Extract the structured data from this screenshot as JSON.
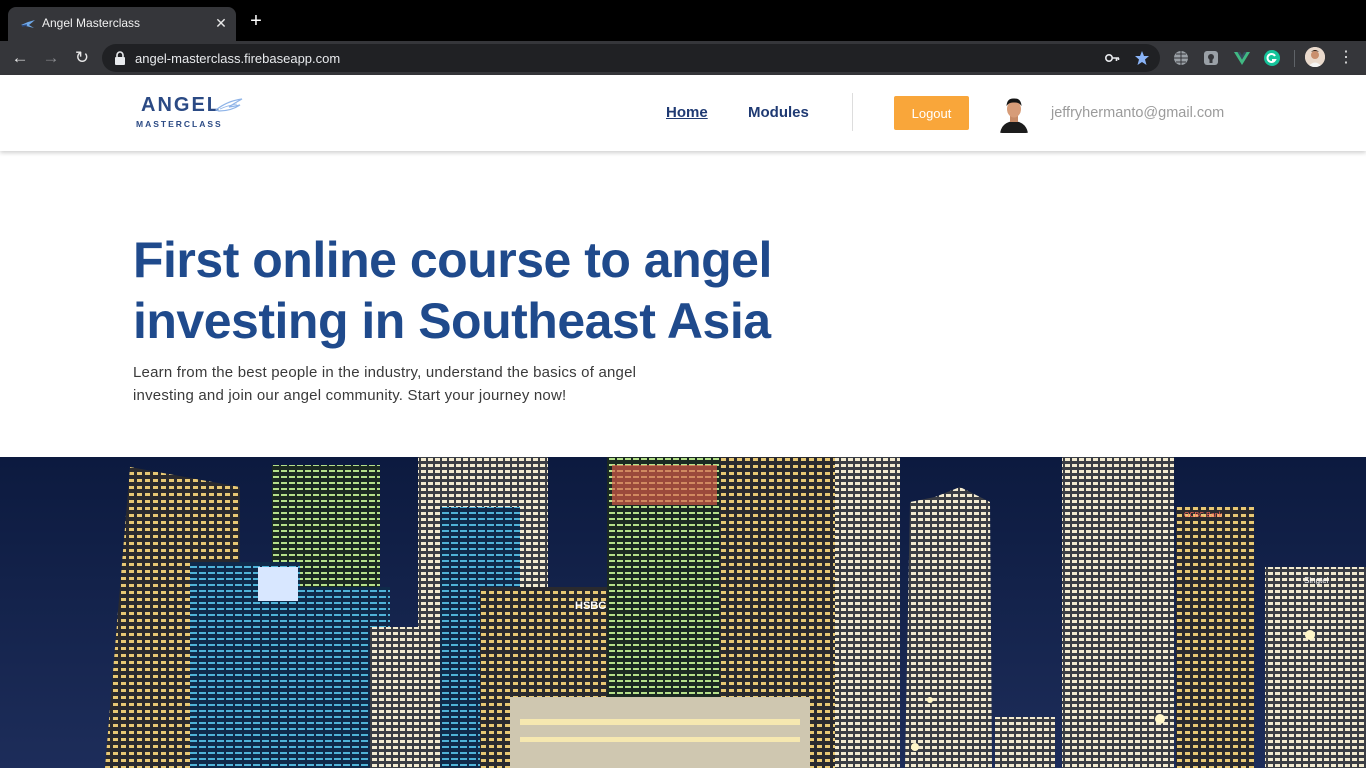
{
  "browser": {
    "tab_title": "Angel Masterclass",
    "url": "angel-masterclass.firebaseapp.com",
    "new_tab_symbol": "+",
    "close_symbol": "✕",
    "back_symbol": "←",
    "forward_symbol": "→",
    "reload_symbol": "↻",
    "menu_symbol": "⋮",
    "extensions": [
      "key-icon",
      "bookmark-star-icon",
      "globe-extension-icon",
      "shield-extension-icon",
      "vue-devtools-icon",
      "grammarly-icon"
    ]
  },
  "header": {
    "logo_word": "ANGEL",
    "logo_sub": "MASTERCLASS",
    "nav": [
      {
        "label": "Home",
        "active": true
      },
      {
        "label": "Modules",
        "active": false
      }
    ],
    "logout_label": "Logout",
    "user_email": "jeffryhermanto@gmail.com"
  },
  "hero": {
    "title": "First online course to angel investing in Southeast Asia",
    "subtitle": "Learn from the best people in the industry, understand the basics of angel investing and join our angel community. Start your journey now!"
  },
  "colors": {
    "brand_blue": "#1f4a8c",
    "logout_orange": "#f9a63a",
    "chrome_dark": "#35363a"
  }
}
